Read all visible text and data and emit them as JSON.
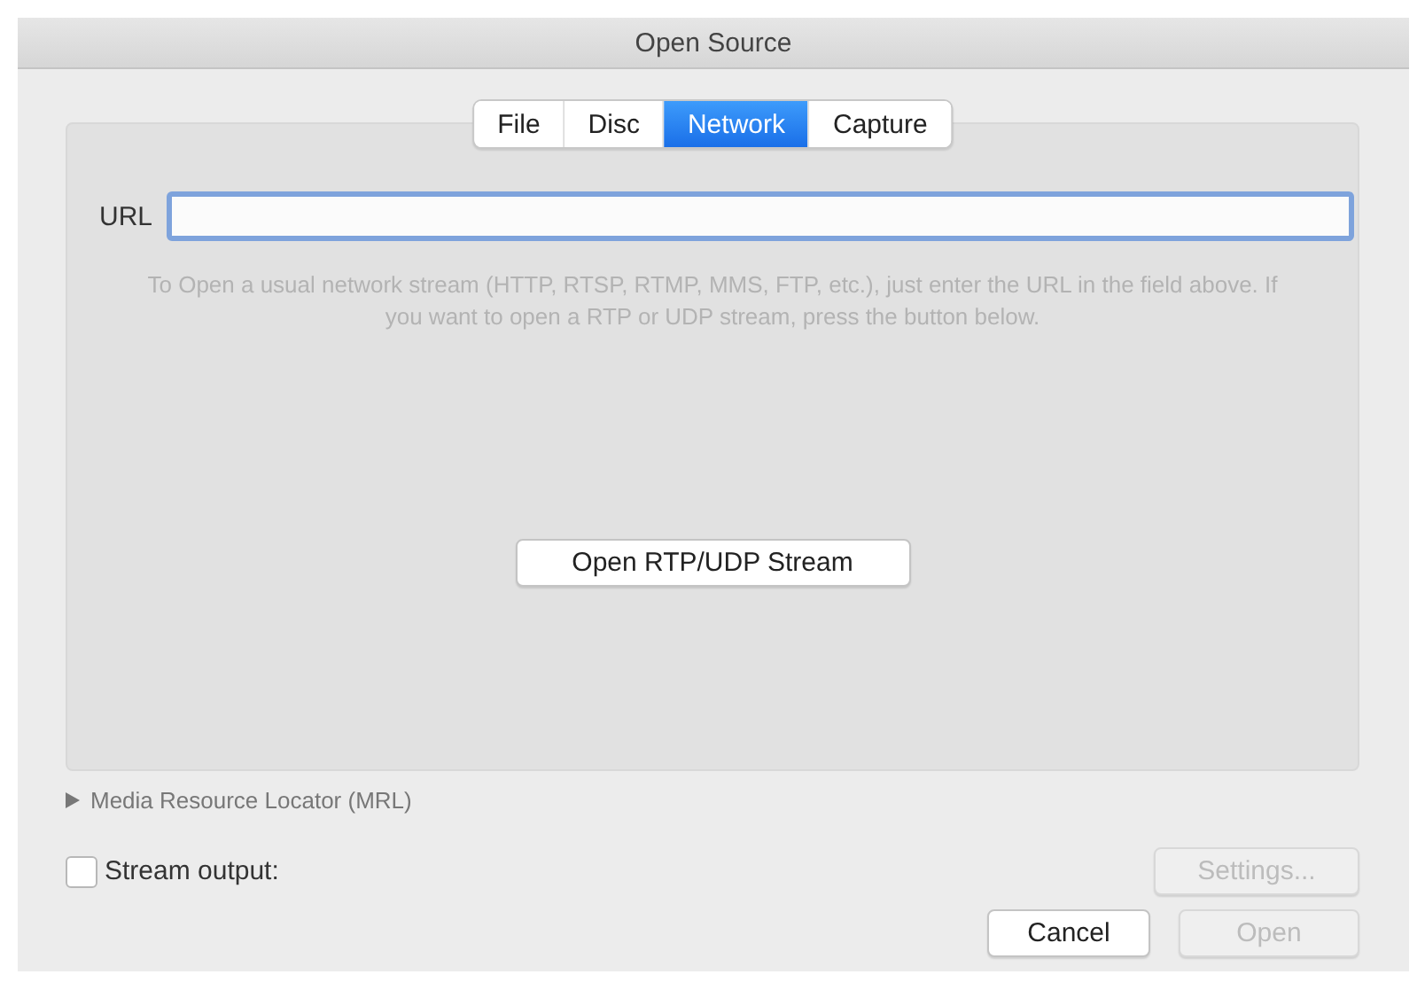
{
  "window": {
    "title": "Open Source"
  },
  "tabs": [
    {
      "label": "File",
      "selected": false
    },
    {
      "label": "Disc",
      "selected": false
    },
    {
      "label": "Network",
      "selected": true
    },
    {
      "label": "Capture",
      "selected": false
    }
  ],
  "url": {
    "label": "URL",
    "focused": true
  },
  "help_text": "To Open a usual network stream (HTTP, RTSP, RTMP, MMS, FTP, etc.), just enter the URL in the field above. If you want to open a RTP or UDP stream, press the button below.",
  "rtp_button": "Open RTP/UDP Stream",
  "mrl": {
    "label": "Media Resource Locator (MRL)",
    "expanded": false
  },
  "stream_output": {
    "label": "Stream output:",
    "checked": false
  },
  "settings_button": {
    "label": "Settings...",
    "disabled": true
  },
  "buttons": [
    {
      "label": "Cancel",
      "disabled": false
    },
    {
      "label": "Open",
      "disabled": true
    }
  ]
}
